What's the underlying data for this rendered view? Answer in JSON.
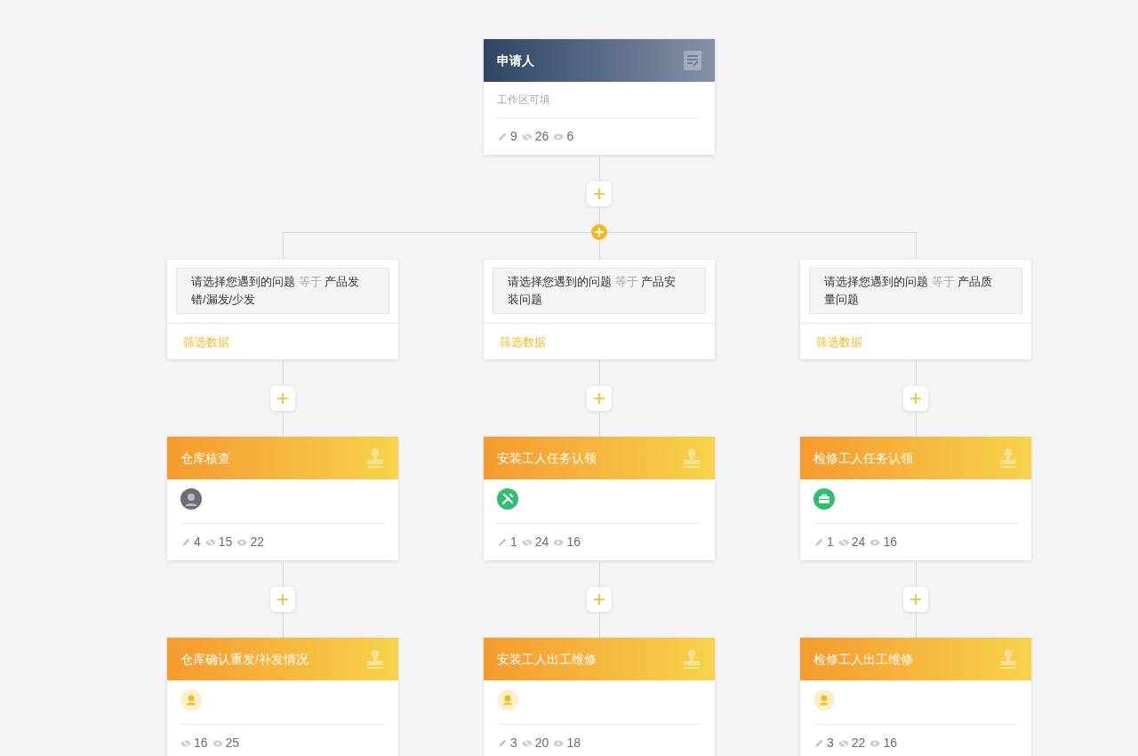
{
  "start_node": {
    "title": "申请人",
    "subtitle": "工作区可填",
    "stats": [
      {
        "kind": "edit",
        "value": "9"
      },
      {
        "kind": "hidden",
        "value": "26"
      },
      {
        "kind": "view",
        "value": "6"
      }
    ]
  },
  "branches": [
    {
      "condition": {
        "field": "请选择您遇到的问题",
        "operator": "等于",
        "value": "产品发错/漏发/少发"
      },
      "link": "筛选数据",
      "nodes": [
        {
          "title": "仓库核查",
          "kind": "photo",
          "stats": [
            {
              "kind": "edit",
              "value": "4"
            },
            {
              "kind": "hidden",
              "value": "15"
            },
            {
              "kind": "view",
              "value": "22"
            }
          ]
        },
        {
          "title": "仓库确认重发/补发情况",
          "kind": "person",
          "stats": [
            {
              "kind": "hidden",
              "value": "16"
            },
            {
              "kind": "view",
              "value": "25"
            }
          ]
        }
      ]
    },
    {
      "condition": {
        "field": "请选择您遇到的问题",
        "operator": "等于",
        "value": "产品安装问题"
      },
      "link": "筛选数据",
      "nodes": [
        {
          "title": "安装工人任务认领",
          "kind": "tools",
          "stats": [
            {
              "kind": "edit",
              "value": "1"
            },
            {
              "kind": "hidden",
              "value": "24"
            },
            {
              "kind": "view",
              "value": "16"
            }
          ]
        },
        {
          "title": "安装工人出工维修",
          "kind": "person",
          "stats": [
            {
              "kind": "edit",
              "value": "3"
            },
            {
              "kind": "hidden",
              "value": "20"
            },
            {
              "kind": "view",
              "value": "18"
            }
          ]
        }
      ]
    },
    {
      "condition": {
        "field": "请选择您遇到的问题",
        "operator": "等于",
        "value": "产品质量问题"
      },
      "link": "筛选数据",
      "nodes": [
        {
          "title": "检修工人任务认领",
          "kind": "briefcase",
          "stats": [
            {
              "kind": "edit",
              "value": "1"
            },
            {
              "kind": "hidden",
              "value": "24"
            },
            {
              "kind": "view",
              "value": "16"
            }
          ]
        },
        {
          "title": "检修工人出工维修",
          "kind": "person",
          "stats": [
            {
              "kind": "edit",
              "value": "3"
            },
            {
              "kind": "hidden",
              "value": "22"
            },
            {
              "kind": "view",
              "value": "16"
            }
          ]
        }
      ]
    }
  ]
}
